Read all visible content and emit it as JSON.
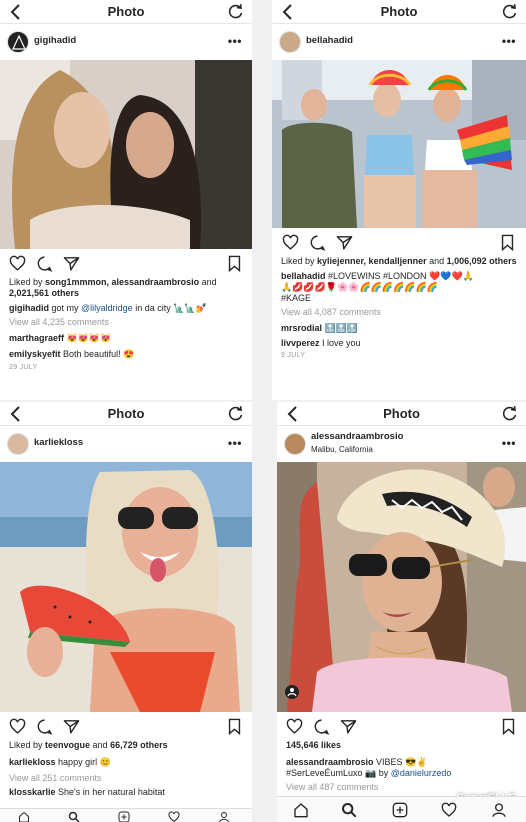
{
  "navbar": {
    "title": "Photo"
  },
  "posts": [
    {
      "username": "gigihadid",
      "likes_prefix": "Liked by ",
      "likers": "song1mmmon, alessandraambrosio",
      "likes_mid": " and ",
      "likes_count": "2,021,561 others",
      "caption_user": "gigihadid",
      "caption_pre": " got my ",
      "caption_mention": "@lilyaldridge",
      "caption_post": " in da city 🗽🗽💅",
      "view_all": "View all 4,235 comments",
      "comments": [
        {
          "user": "marthagraeff",
          "text": " 😻😻😻😻"
        },
        {
          "user": "emilyskyefit",
          "text": " Both beautiful! 😍"
        }
      ],
      "date": "29 JULY"
    },
    {
      "username": "bellahadid",
      "likes_prefix": "Liked by ",
      "likers": "kyliejenner, kendalljenner",
      "likes_mid": " and ",
      "likes_count": "1,006,092 others",
      "caption_user": "bellahadid",
      "caption_text": " #LOVEWINS #LONDON ❤️💙❤️🙏",
      "caption_line2": "🙏💋💋💋🌹🌸🌸🌈🌈🌈🌈🌈🌈🌈",
      "caption_line3": "#KAGE",
      "view_all": "View all 4,087 comments",
      "comments": [
        {
          "user": "mrsrodial",
          "text": " 🔝🔝🔝"
        },
        {
          "user": "livvperez",
          "text": " I love you"
        }
      ],
      "date": "9 JULY"
    },
    {
      "username": "karliekloss",
      "likes_prefix": "Liked by ",
      "likers": "teenvogue",
      "likes_mid": " and ",
      "likes_count": "66,729 others",
      "caption_user": "karliekloss",
      "caption_text": " happy girl 😊",
      "view_all": "View all 251 comments",
      "comments": [
        {
          "user": "klosskarlie",
          "text": " She's in her natural habitat"
        }
      ]
    },
    {
      "username": "alessandraambrosio",
      "location": "Malibu, California",
      "likes_total": "145,646 likes",
      "caption_user": "alessandraambrosio",
      "caption_text": " VIBES 😎✌️",
      "caption_line2": "#SerLeveÉumLuxo 📷 by ",
      "caption_mention": "@danielurzedo",
      "view_all": "View all 487 comments"
    }
  ],
  "watermark": "SuperELLE"
}
